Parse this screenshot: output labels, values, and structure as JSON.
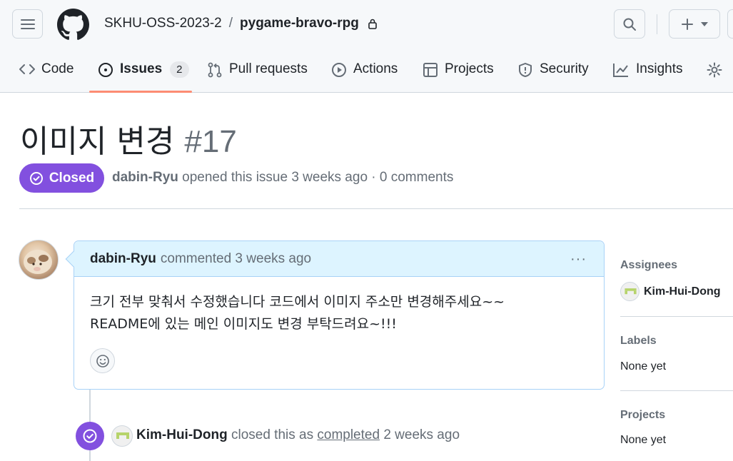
{
  "repo": {
    "owner": "SKHU-OSS-2023-2",
    "separator": "/",
    "name": "pygame-bravo-rpg"
  },
  "tabs": [
    {
      "label": "Code",
      "icon": "code-icon"
    },
    {
      "label": "Issues",
      "icon": "issue-opened-icon",
      "count": "2"
    },
    {
      "label": "Pull requests",
      "icon": "git-pull-request-icon"
    },
    {
      "label": "Actions",
      "icon": "play-icon"
    },
    {
      "label": "Projects",
      "icon": "table-icon"
    },
    {
      "label": "Security",
      "icon": "shield-icon"
    },
    {
      "label": "Insights",
      "icon": "graph-icon"
    }
  ],
  "issue": {
    "title": "이미지 변경",
    "number": "#17",
    "state": "Closed",
    "author": "dabin-Ryu",
    "meta": " opened this issue 3 weeks ago · 0 comments"
  },
  "comment": {
    "author": "dabin-Ryu",
    "action": "commented 3 weeks ago",
    "menu": "···",
    "lines": [
      "크기 전부 맞춰서 수정했습니다 코드에서 이미지 주소만 변경해주세요~~",
      "README에 있는 메인 이미지도 변경 부탁드려요~!!!"
    ]
  },
  "event": {
    "actor": "Kim-Hui-Dong",
    "text1": " closed this as ",
    "link": "completed",
    "text2": " 2 weeks ago"
  },
  "sidebar": {
    "assignees_label": "Assignees",
    "assignee": "Kim-Hui-Dong",
    "labels_label": "Labels",
    "labels_value": "None yet",
    "projects_label": "Projects",
    "projects_value": "None yet"
  },
  "colors": {
    "accent_purple": "#8250df",
    "tab_underline": "#fd8c73",
    "comment_header": "#ddf4ff"
  }
}
